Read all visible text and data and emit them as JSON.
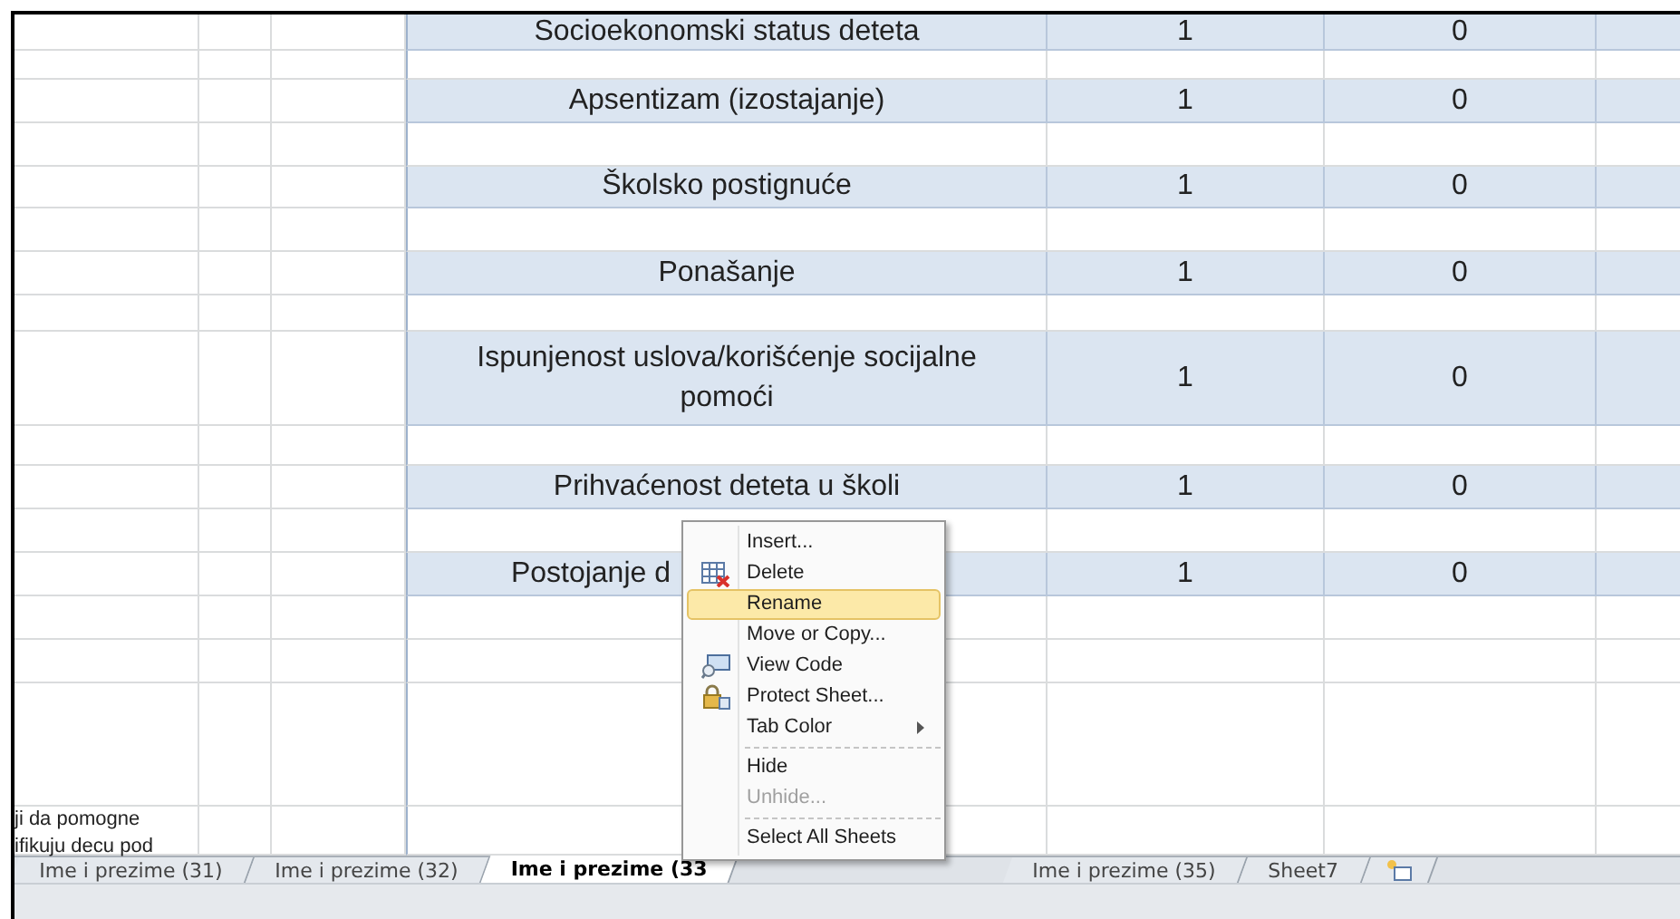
{
  "sheet": {
    "rows": [
      {
        "kind": "data",
        "label": "Socioekonomski status deteta",
        "col_e": "1",
        "col_f": "0"
      },
      {
        "kind": "blank"
      },
      {
        "kind": "data",
        "label": "Apsentizam (izostajanje)",
        "col_e": "1",
        "col_f": "0"
      },
      {
        "kind": "blank"
      },
      {
        "kind": "data",
        "label": "Školsko postignuće",
        "col_e": "1",
        "col_f": "0"
      },
      {
        "kind": "blank"
      },
      {
        "kind": "data",
        "label": "Ponašanje",
        "col_e": "1",
        "col_f": "0"
      },
      {
        "kind": "blank"
      },
      {
        "kind": "data",
        "label": "Ispunjenost uslova/korišćenje socijalne pomoći",
        "col_e": "1",
        "col_f": "0"
      },
      {
        "kind": "blank"
      },
      {
        "kind": "data",
        "label": "Prihvaćenost deteta u školi",
        "col_e": "1",
        "col_f": "0"
      },
      {
        "kind": "blank"
      },
      {
        "kind": "covered",
        "label": "Postojanje d",
        "col_e": "1",
        "col_f": "0"
      },
      {
        "kind": "blank"
      },
      {
        "kind": "blank"
      },
      {
        "kind": "blank"
      },
      {
        "kind": "note",
        "lines": [
          "ji da pomogne",
          "ifikuju decu pod"
        ]
      }
    ]
  },
  "context_menu": {
    "items": [
      {
        "kind": "item",
        "label": "Insert...",
        "selected": false,
        "disabled": false
      },
      {
        "kind": "item",
        "label": "Delete",
        "selected": false,
        "disabled": false
      },
      {
        "kind": "item",
        "label": "Rename",
        "selected": true,
        "disabled": false
      },
      {
        "kind": "item",
        "label": "Move or Copy...",
        "selected": false,
        "disabled": false
      },
      {
        "kind": "item",
        "label": "View Code",
        "selected": false,
        "disabled": false
      },
      {
        "kind": "item",
        "label": "Protect Sheet...",
        "selected": false,
        "disabled": false
      },
      {
        "kind": "submenu",
        "label": "Tab Color",
        "selected": false,
        "disabled": false
      },
      {
        "kind": "separator"
      },
      {
        "kind": "item",
        "label": "Hide",
        "selected": false,
        "disabled": false
      },
      {
        "kind": "item",
        "label": "Unhide...",
        "selected": false,
        "disabled": true
      },
      {
        "kind": "separator"
      },
      {
        "kind": "item",
        "label": "Select All Sheets",
        "selected": false,
        "disabled": false
      }
    ]
  },
  "sheet_tabs": [
    {
      "label": "Ime i prezime (31)",
      "selected": false
    },
    {
      "label": "Ime i prezime (32)",
      "selected": false
    },
    {
      "label": "Ime i prezime (33",
      "selected": true
    },
    {
      "kind": "hidden"
    },
    {
      "label": "Ime i prezime (35)",
      "selected": false
    },
    {
      "label": "Sheet7",
      "selected": false
    }
  ]
}
